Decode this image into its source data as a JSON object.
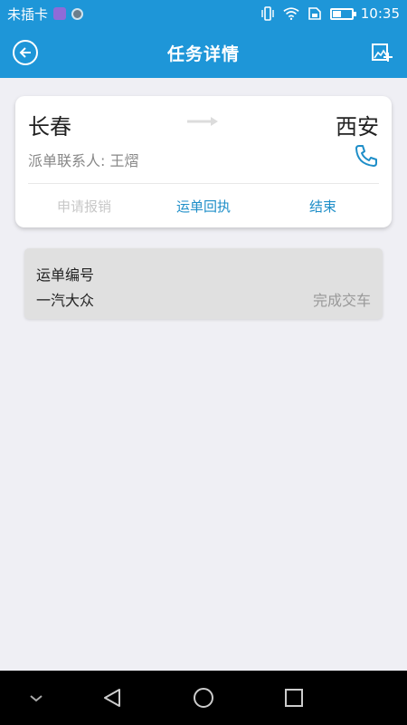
{
  "status_bar": {
    "carrier": "未插卡",
    "time": "10:35"
  },
  "app_bar": {
    "title": "任务详情"
  },
  "route": {
    "from": "长春",
    "to": "西安",
    "contact_label": "派单联系人:",
    "contact_name": "王熠",
    "actions": {
      "apply_reimburse": "申请报销",
      "waybill_receipt": "运单回执",
      "finish": "结束"
    }
  },
  "waybill": {
    "label": "运单编号",
    "company": "一汽大众",
    "status": "完成交车"
  },
  "colors": {
    "primary": "#1e96d8",
    "link": "#1e8ec8",
    "disabled": "#c8c8c8",
    "background": "#efeff4"
  }
}
